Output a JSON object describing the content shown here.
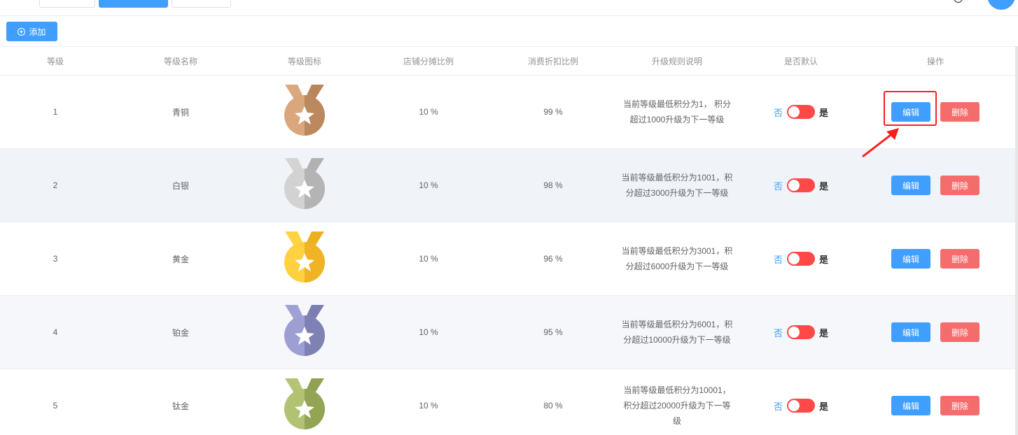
{
  "toolbar": {
    "add_label": "添加"
  },
  "table": {
    "headers": [
      "等级",
      "等级名称",
      "等级图标",
      "店铺分摊比例",
      "消费折扣比例",
      "升级规则说明",
      "是否默认",
      "操作"
    ],
    "rows": [
      {
        "level": "1",
        "name": "青铜",
        "medal_color": "#c8956a",
        "share": "10 %",
        "discount": "99 %",
        "rule": "当前等级最低积分为1， 积分超过1000升级为下一等级",
        "switch_off": "否",
        "switch_on": "是",
        "edit": "编辑",
        "delete": "删除"
      },
      {
        "level": "2",
        "name": "白银",
        "medal_color": "#c0c0c0",
        "share": "10 %",
        "discount": "98 %",
        "rule": "当前等级最低积分为1001，积分超过3000升级为下一等级",
        "switch_off": "否",
        "switch_on": "是",
        "edit": "编辑",
        "delete": "删除"
      },
      {
        "level": "3",
        "name": "黄金",
        "medal_color": "#fbbf2f",
        "share": "10 %",
        "discount": "96 %",
        "rule": "当前等级最低积分为3001，积分超过6000升级为下一等级",
        "switch_off": "否",
        "switch_on": "是",
        "edit": "编辑",
        "delete": "删除"
      },
      {
        "level": "4",
        "name": "铂金",
        "medal_color": "#8b8dc0",
        "share": "10 %",
        "discount": "95 %",
        "rule": "当前等级最低积分为6001，积分超过10000升级为下一等级",
        "switch_off": "否",
        "switch_on": "是",
        "edit": "编辑",
        "delete": "删除"
      },
      {
        "level": "5",
        "name": "钛金",
        "medal_color": "#9fb160",
        "share": "10 %",
        "discount": "80 %",
        "rule": "当前等级最低积分为10001，积分超过20000升级为下一等级",
        "switch_off": "否",
        "switch_on": "是",
        "edit": "编辑",
        "delete": "删除"
      }
    ]
  },
  "colors": {
    "primary": "#409eff",
    "danger": "#f56c6c",
    "switch_active": "#ff4949",
    "annotation": "#ff1e1e"
  }
}
